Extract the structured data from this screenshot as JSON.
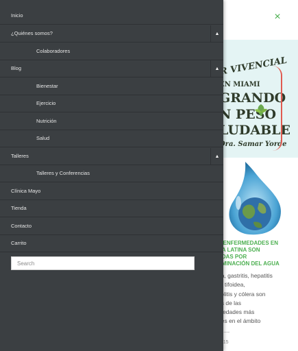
{
  "header": {
    "close_glyph": "×"
  },
  "banner": {
    "lines": [
      "R VIVENCIAL",
      "EN MIAMI",
      "GRANDO",
      "N PESO",
      "LUDABLE",
      "Dra. Samar Yorde"
    ]
  },
  "article": {
    "title_lines": [
      "E ENFERMEDADES EN",
      "CA LATINA SON",
      "ADAS POR",
      "AMINACIÓN DEL AGUA"
    ],
    "body_lines": [
      "ea, gastritis, hepatitis",
      "re tifoidea,",
      "colitis y cólera son",
      "as de las",
      "medades más",
      "nes en el ámbito",
      "al.…"
    ],
    "date": "2015"
  },
  "menu": {
    "items": [
      {
        "label": "Inicio",
        "level": 0,
        "toggle": ""
      },
      {
        "label": "¿Quiénes somos?",
        "level": 0,
        "toggle": "▲"
      },
      {
        "label": "Colaboradores",
        "level": 1,
        "toggle": ""
      },
      {
        "label": "Blog",
        "level": 0,
        "toggle": "▲"
      },
      {
        "label": "Bienestar",
        "level": 1,
        "toggle": ""
      },
      {
        "label": "Ejercicio",
        "level": 1,
        "toggle": ""
      },
      {
        "label": "Nutrición",
        "level": 1,
        "toggle": ""
      },
      {
        "label": "Salud",
        "level": 1,
        "toggle": ""
      },
      {
        "label": "Talleres",
        "level": 0,
        "toggle": "▲"
      },
      {
        "label": "Talleres y Conferencias",
        "level": 1,
        "toggle": ""
      },
      {
        "label": "Clínica Mayo",
        "level": 0,
        "toggle": ""
      },
      {
        "label": "Tienda",
        "level": 0,
        "toggle": ""
      },
      {
        "label": "Contacto",
        "level": 0,
        "toggle": ""
      },
      {
        "label": "Carrito",
        "level": 0,
        "toggle": ""
      }
    ]
  },
  "search": {
    "placeholder": "Search",
    "value": ""
  },
  "colors": {
    "drawer_bg": "#3b3f42",
    "accent": "#4caf50",
    "menu_text": "#e6e6e6"
  }
}
